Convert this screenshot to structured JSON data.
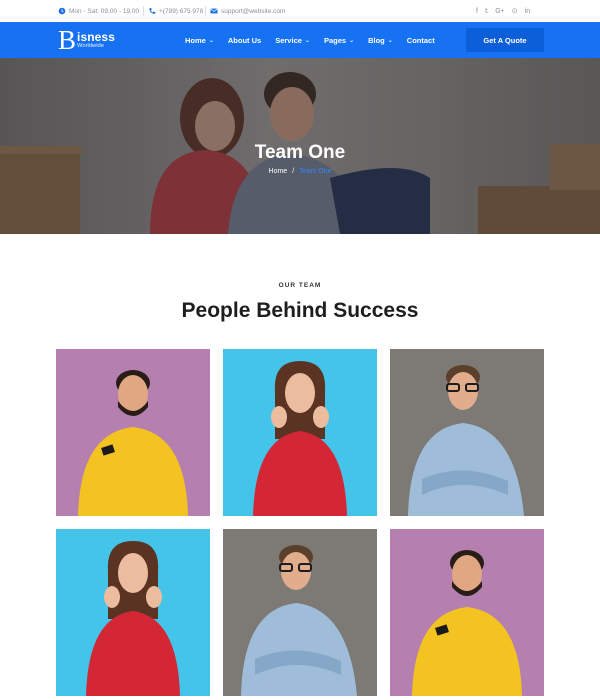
{
  "topbar": {
    "hours": "Mon - Sat: 09.00 - 19.00",
    "phone": "+(789) 675 978",
    "email": "support@website.com",
    "social": [
      "f",
      "𝕥",
      "G+",
      "⊙",
      "in"
    ]
  },
  "brand": {
    "initial": "B",
    "name": "isness",
    "tagline": "Worldwide"
  },
  "nav": {
    "items": [
      {
        "label": "Home",
        "dropdown": true
      },
      {
        "label": "About Us",
        "dropdown": false
      },
      {
        "label": "Service",
        "dropdown": true
      },
      {
        "label": "Pages",
        "dropdown": true
      },
      {
        "label": "Blog",
        "dropdown": true
      },
      {
        "label": "Contact",
        "dropdown": false
      }
    ],
    "cta": "Get A Quote"
  },
  "hero": {
    "title": "Team One",
    "breadcrumb": {
      "home": "Home",
      "separator": "/",
      "current": "Team One"
    }
  },
  "section": {
    "eyebrow": "OUR TEAM",
    "title": "People Behind Success"
  },
  "team": [
    {
      "bg": "#b57fb0",
      "person": "man-beard-yellow-hoodie"
    },
    {
      "bg": "#45c4ea",
      "person": "woman-red-sweater"
    },
    {
      "bg": "#7d7a76",
      "person": "man-glasses-denim-shirt"
    },
    {
      "bg": "#45c4ea",
      "person": "woman-red-sweater"
    },
    {
      "bg": "#7d7a76",
      "person": "man-glasses-denim-shirt"
    },
    {
      "bg": "#b57fb0",
      "person": "man-beard-yellow-hoodie"
    }
  ],
  "colors": {
    "brand": "#1672f3",
    "accent": "#2f86ff",
    "cta": "#0d5fd9"
  }
}
